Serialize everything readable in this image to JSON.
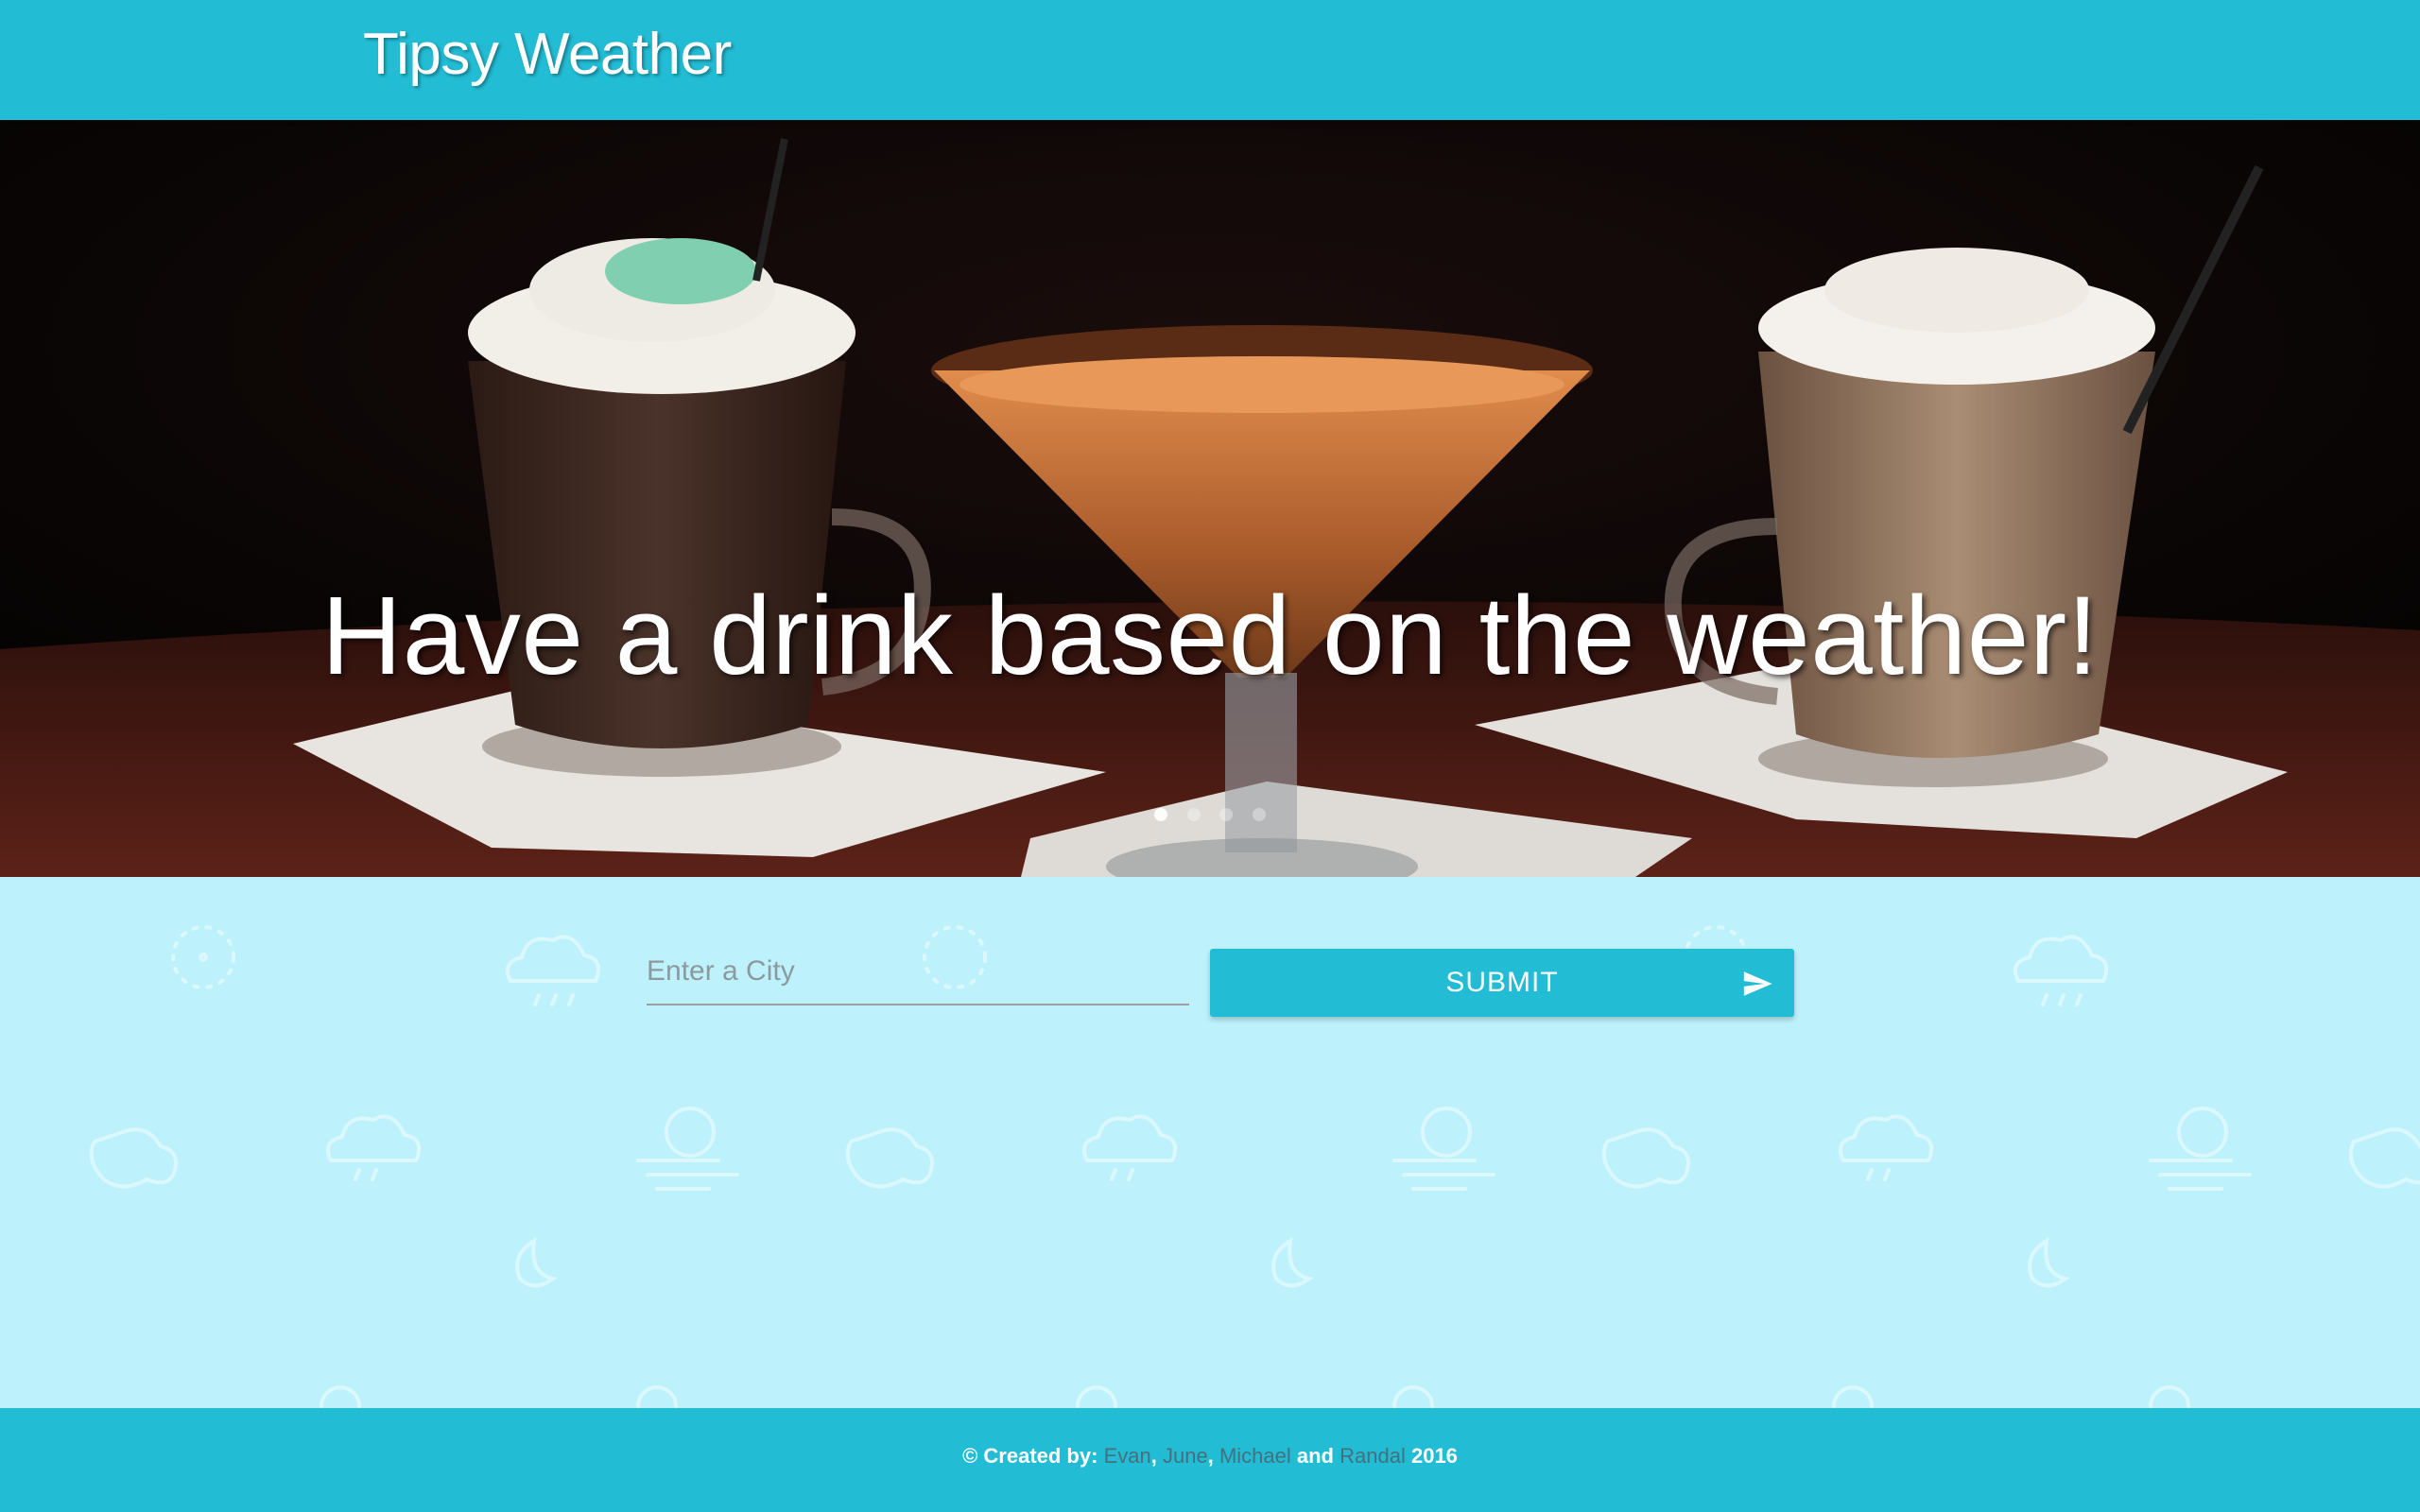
{
  "header": {
    "brand": "Tipsy Weather"
  },
  "hero": {
    "caption": "Have a drink based on the weather!",
    "slides": 4,
    "active_slide": 1
  },
  "form": {
    "city_placeholder": "Enter a City",
    "city_value": "",
    "submit_label": "SUBMIT",
    "submit_icon": "send-icon"
  },
  "footer": {
    "prefix": "© Created by:",
    "authors": [
      "Evan",
      "June",
      "Michael",
      "Randal"
    ],
    "sep1": ",",
    "sep2": ",",
    "conj": "and",
    "year": "2016"
  },
  "colors": {
    "primary": "#22bcd4",
    "background": "#bdf2fd",
    "footer_link": "#46707c"
  }
}
